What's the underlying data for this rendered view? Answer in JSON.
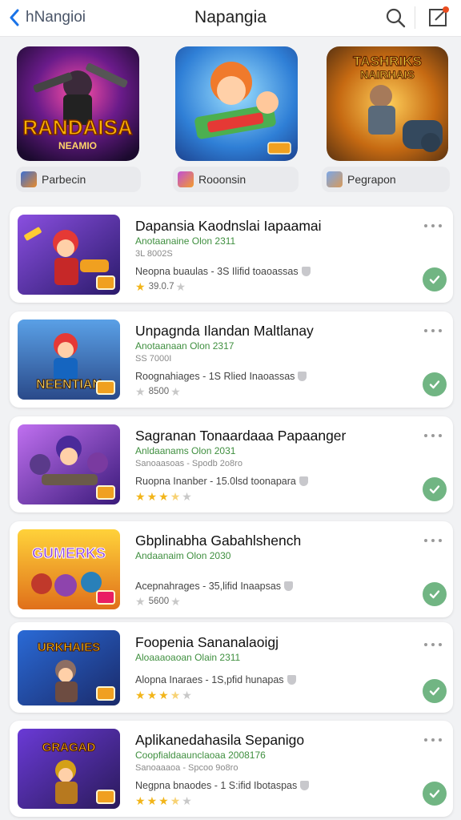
{
  "header": {
    "back_label": "hNangioi",
    "title": "Napangia"
  },
  "featured": [
    {
      "art_title": "RANDAISA",
      "art_sub": "NEAMIO",
      "chip_label": "Parbecin"
    },
    {
      "art_title": "",
      "art_sub": "",
      "chip_label": "Rooonsin"
    },
    {
      "art_title": "TASHRIKS",
      "art_sub": "NAIRHAIS",
      "chip_label": "Pegrapon"
    }
  ],
  "apps": [
    {
      "title": "Dapansia Kaodnslai Iapaamai",
      "sub": "Anotaanaine Olon 2311",
      "meta": "3L 8002S",
      "info": "Neopna buaulas -  3S Ilifid toaoassas",
      "rating": "39.0.7",
      "stars": 1,
      "thumb_text": ""
    },
    {
      "title": "Unpagnda Ilandan Maltlanay",
      "sub": "Anotaanaan Olon 2317",
      "meta": "SS 7000I",
      "info": "Roognahiages -  1S Rlied Inaoassas",
      "rating": "8500",
      "stars": 0,
      "thumb_text": "NEENTIAN"
    },
    {
      "title": "Sagranan Tonaardaaa Papaanger",
      "sub": "Anldaanams Olon 2031",
      "meta": "Sanoaasoas - Spodb 2o8ro",
      "info": "Ruopna Inanber -  15.0lsd toonapara",
      "rating": "",
      "stars": 3.5,
      "thumb_text": ""
    },
    {
      "title": "Gbplinabha Gabahlshench",
      "sub": "Andaanaim Olon 2030",
      "meta": "",
      "info": "Acepnahrages -  35,lifid Inaapsas",
      "rating": "5600",
      "stars": 0,
      "thumb_text": "GUMERKS"
    },
    {
      "title": "Foopenia Sananalaoigj",
      "sub": "Aloaaaoaoan Olain 2311",
      "meta": "",
      "info": "Alopna Inaraes -  1S,pfid hunapas",
      "rating": "",
      "stars": 3.5,
      "thumb_text": "URKHAIES"
    },
    {
      "title": "Aplikanedahasila Sepanigo",
      "sub": "Coopfialdaaunclaoaa 2008176",
      "meta": "Sanoaaaoa - Spcoo 9o8ro",
      "info": "Negpna bnaodes -  1 S:ifid Ibotaspas",
      "rating": "",
      "stars": 3.5,
      "thumb_text": "GRAGAD"
    }
  ],
  "colors": {
    "accent_blue": "#1a73e8",
    "installed_green": "#71b583",
    "star_gold": "#f2b51a",
    "subtitle_green": "#3f8f3f"
  }
}
